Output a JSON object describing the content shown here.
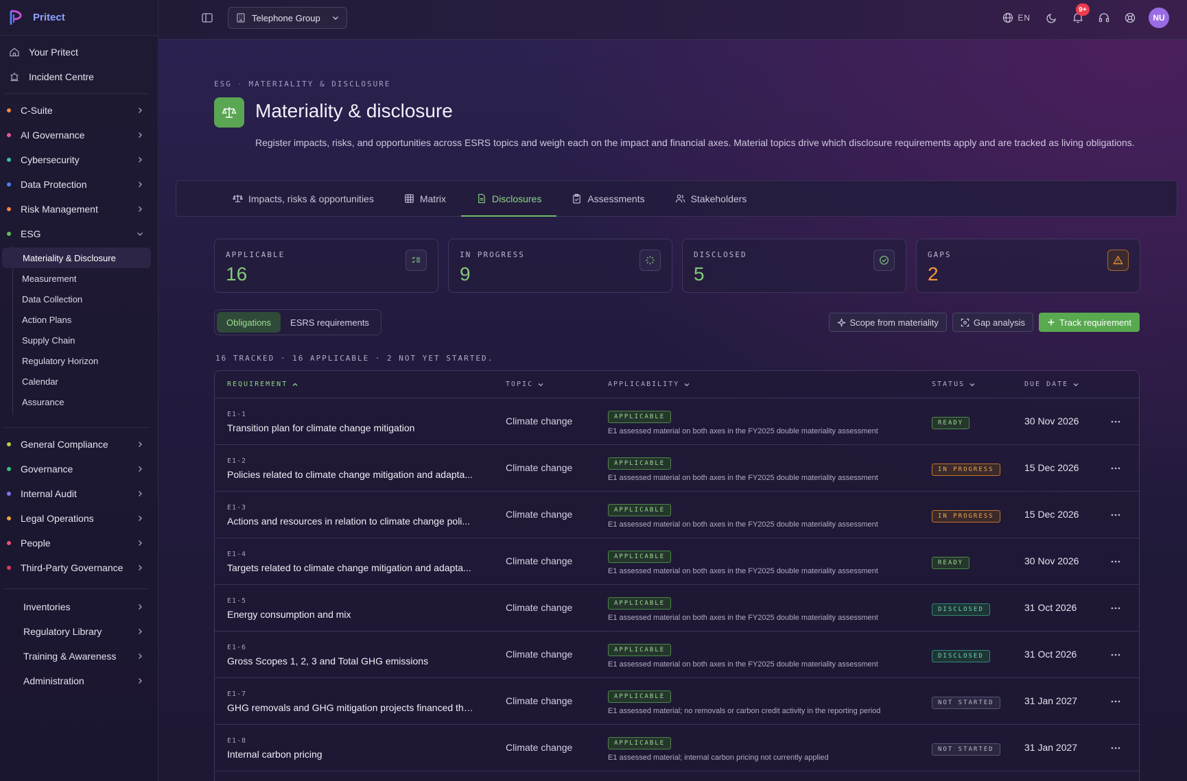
{
  "app": {
    "brand": "Pritect",
    "org": "Telephone Group",
    "lang": "EN",
    "notifications": "9+",
    "avatar": "NU"
  },
  "sidebar": {
    "top": [
      {
        "label": "Your Pritect",
        "icon": "home-icon"
      },
      {
        "label": "Incident Centre",
        "icon": "siren-icon"
      }
    ],
    "groups": [
      {
        "label": "C-Suite",
        "color": "#f08a3c"
      },
      {
        "label": "AI Governance",
        "color": "#e9559a"
      },
      {
        "label": "Cybersecurity",
        "color": "#34c1b5"
      },
      {
        "label": "Data Protection",
        "color": "#4f7df2"
      },
      {
        "label": "Risk Management",
        "color": "#f0873c"
      },
      {
        "label": "ESG",
        "color": "#5fbf55"
      }
    ],
    "esg_sub": [
      "Materiality & Disclosure",
      "Measurement",
      "Data Collection",
      "Action Plans",
      "Supply Chain",
      "Regulatory Horizon",
      "Calendar",
      "Assurance"
    ],
    "groups2": [
      {
        "label": "General Compliance",
        "color": "#b9d23a"
      },
      {
        "label": "Governance",
        "color": "#34c17f"
      },
      {
        "label": "Internal Audit",
        "color": "#7a78f0"
      },
      {
        "label": "Legal Operations",
        "color": "#f0a03c"
      },
      {
        "label": "People",
        "color": "#f04f72"
      },
      {
        "label": "Third-Party Governance",
        "color": "#e03a55"
      }
    ],
    "plain": [
      "Inventories",
      "Regulatory Library",
      "Training & Awareness",
      "Administration"
    ]
  },
  "page": {
    "breadcrumb": [
      "ESG",
      "MATERIALITY & DISCLOSURE"
    ],
    "title": "Materiality & disclosure",
    "description": "Register impacts, risks, and opportunities across ESRS topics and weigh each on the impact and financial axes. Material topics drive which disclosure requirements apply and are tracked as living obligations."
  },
  "tabs": [
    {
      "label": "Impacts, risks & opportunities",
      "icon": "scale-icon"
    },
    {
      "label": "Matrix",
      "icon": "grid-icon"
    },
    {
      "label": "Disclosures",
      "icon": "document-icon"
    },
    {
      "label": "Assessments",
      "icon": "clipboard-icon"
    },
    {
      "label": "Stakeholders",
      "icon": "users-icon"
    }
  ],
  "stats": [
    {
      "label": "APPLICABLE",
      "value": "16",
      "icon": "checklist-icon"
    },
    {
      "label": "IN PROGRESS",
      "value": "9",
      "icon": "loader-icon"
    },
    {
      "label": "DISCLOSED",
      "value": "5",
      "icon": "check-circle-icon"
    },
    {
      "label": "GAPS",
      "value": "2",
      "icon": "warning-icon"
    }
  ],
  "segments": [
    "Obligations",
    "ESRS requirements"
  ],
  "actions": {
    "scope": "Scope from materiality",
    "gap": "Gap analysis",
    "track": "Track requirement"
  },
  "summary": "16 TRACKED · 16 APPLICABLE · 2 NOT YET STARTED.",
  "table": {
    "headers": {
      "requirement": "REQUIREMENT",
      "topic": "TOPIC",
      "applicability": "APPLICABILITY",
      "status": "STATUS",
      "due": "DUE DATE"
    },
    "rows": [
      {
        "code": "E1-1",
        "name": "Transition plan for climate change mitigation",
        "topic": "Climate change",
        "applicability": "APPLICABLE",
        "note": "E1 assessed material on both axes in the FY2025 double materiality assessment",
        "status": "READY",
        "status_kind": "ready",
        "due": "30 Nov 2026"
      },
      {
        "code": "E1-2",
        "name": "Policies related to climate change mitigation and adapta...",
        "topic": "Climate change",
        "applicability": "APPLICABLE",
        "note": "E1 assessed material on both axes in the FY2025 double materiality assessment",
        "status": "IN PROGRESS",
        "status_kind": "inprogress",
        "due": "15 Dec 2026"
      },
      {
        "code": "E1-3",
        "name": "Actions and resources in relation to climate change poli...",
        "topic": "Climate change",
        "applicability": "APPLICABLE",
        "note": "E1 assessed material on both axes in the FY2025 double materiality assessment",
        "status": "IN PROGRESS",
        "status_kind": "inprogress",
        "due": "15 Dec 2026"
      },
      {
        "code": "E1-4",
        "name": "Targets related to climate change mitigation and adapta...",
        "topic": "Climate change",
        "applicability": "APPLICABLE",
        "note": "E1 assessed material on both axes in the FY2025 double materiality assessment",
        "status": "READY",
        "status_kind": "ready",
        "due": "30 Nov 2026"
      },
      {
        "code": "E1-5",
        "name": "Energy consumption and mix",
        "topic": "Climate change",
        "applicability": "APPLICABLE",
        "note": "E1 assessed material on both axes in the FY2025 double materiality assessment",
        "status": "DISCLOSED",
        "status_kind": "disclosed",
        "due": "31 Oct 2026"
      },
      {
        "code": "E1-6",
        "name": "Gross Scopes 1, 2, 3 and Total GHG emissions",
        "topic": "Climate change",
        "applicability": "APPLICABLE",
        "note": "E1 assessed material on both axes in the FY2025 double materiality assessment",
        "status": "DISCLOSED",
        "status_kind": "disclosed",
        "due": "31 Oct 2026"
      },
      {
        "code": "E1-7",
        "name": "GHG removals and GHG mitigation projects financed thr...",
        "topic": "Climate change",
        "applicability": "APPLICABLE",
        "note": "E1 assessed material; no removals or carbon credit activity in the reporting period",
        "status": "NOT STARTED",
        "status_kind": "notstarted",
        "due": "31 Jan 2027"
      },
      {
        "code": "E1-8",
        "name": "Internal carbon pricing",
        "topic": "Climate change",
        "applicability": "APPLICABLE",
        "note": "E1 assessed material; internal carbon pricing not currently applied",
        "status": "NOT STARTED",
        "status_kind": "notstarted",
        "due": "31 Jan 2027"
      }
    ]
  }
}
